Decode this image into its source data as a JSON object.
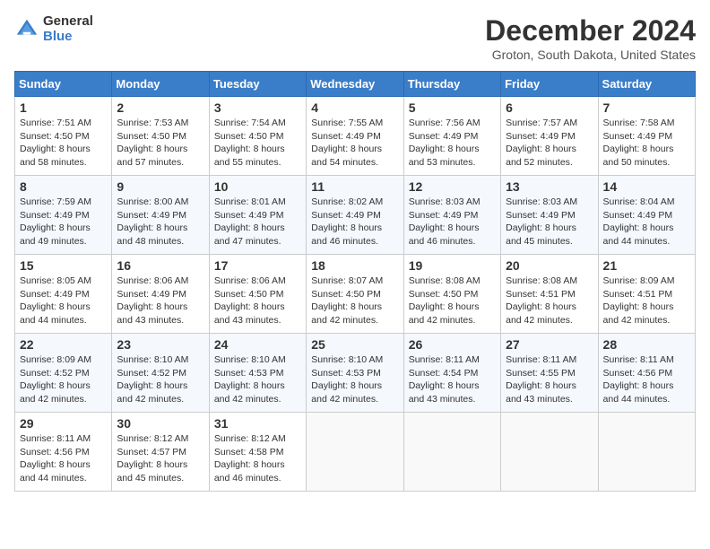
{
  "header": {
    "logo_general": "General",
    "logo_blue": "Blue",
    "month_title": "December 2024",
    "location": "Groton, South Dakota, United States"
  },
  "days_of_week": [
    "Sunday",
    "Monday",
    "Tuesday",
    "Wednesday",
    "Thursday",
    "Friday",
    "Saturday"
  ],
  "weeks": [
    [
      {
        "day": "1",
        "sunrise": "7:51 AM",
        "sunset": "4:50 PM",
        "daylight": "8 hours and 58 minutes."
      },
      {
        "day": "2",
        "sunrise": "7:53 AM",
        "sunset": "4:50 PM",
        "daylight": "8 hours and 57 minutes."
      },
      {
        "day": "3",
        "sunrise": "7:54 AM",
        "sunset": "4:50 PM",
        "daylight": "8 hours and 55 minutes."
      },
      {
        "day": "4",
        "sunrise": "7:55 AM",
        "sunset": "4:49 PM",
        "daylight": "8 hours and 54 minutes."
      },
      {
        "day": "5",
        "sunrise": "7:56 AM",
        "sunset": "4:49 PM",
        "daylight": "8 hours and 53 minutes."
      },
      {
        "day": "6",
        "sunrise": "7:57 AM",
        "sunset": "4:49 PM",
        "daylight": "8 hours and 52 minutes."
      },
      {
        "day": "7",
        "sunrise": "7:58 AM",
        "sunset": "4:49 PM",
        "daylight": "8 hours and 50 minutes."
      }
    ],
    [
      {
        "day": "8",
        "sunrise": "7:59 AM",
        "sunset": "4:49 PM",
        "daylight": "8 hours and 49 minutes."
      },
      {
        "day": "9",
        "sunrise": "8:00 AM",
        "sunset": "4:49 PM",
        "daylight": "8 hours and 48 minutes."
      },
      {
        "day": "10",
        "sunrise": "8:01 AM",
        "sunset": "4:49 PM",
        "daylight": "8 hours and 47 minutes."
      },
      {
        "day": "11",
        "sunrise": "8:02 AM",
        "sunset": "4:49 PM",
        "daylight": "8 hours and 46 minutes."
      },
      {
        "day": "12",
        "sunrise": "8:03 AM",
        "sunset": "4:49 PM",
        "daylight": "8 hours and 46 minutes."
      },
      {
        "day": "13",
        "sunrise": "8:03 AM",
        "sunset": "4:49 PM",
        "daylight": "8 hours and 45 minutes."
      },
      {
        "day": "14",
        "sunrise": "8:04 AM",
        "sunset": "4:49 PM",
        "daylight": "8 hours and 44 minutes."
      }
    ],
    [
      {
        "day": "15",
        "sunrise": "8:05 AM",
        "sunset": "4:49 PM",
        "daylight": "8 hours and 44 minutes."
      },
      {
        "day": "16",
        "sunrise": "8:06 AM",
        "sunset": "4:49 PM",
        "daylight": "8 hours and 43 minutes."
      },
      {
        "day": "17",
        "sunrise": "8:06 AM",
        "sunset": "4:50 PM",
        "daylight": "8 hours and 43 minutes."
      },
      {
        "day": "18",
        "sunrise": "8:07 AM",
        "sunset": "4:50 PM",
        "daylight": "8 hours and 42 minutes."
      },
      {
        "day": "19",
        "sunrise": "8:08 AM",
        "sunset": "4:50 PM",
        "daylight": "8 hours and 42 minutes."
      },
      {
        "day": "20",
        "sunrise": "8:08 AM",
        "sunset": "4:51 PM",
        "daylight": "8 hours and 42 minutes."
      },
      {
        "day": "21",
        "sunrise": "8:09 AM",
        "sunset": "4:51 PM",
        "daylight": "8 hours and 42 minutes."
      }
    ],
    [
      {
        "day": "22",
        "sunrise": "8:09 AM",
        "sunset": "4:52 PM",
        "daylight": "8 hours and 42 minutes."
      },
      {
        "day": "23",
        "sunrise": "8:10 AM",
        "sunset": "4:52 PM",
        "daylight": "8 hours and 42 minutes."
      },
      {
        "day": "24",
        "sunrise": "8:10 AM",
        "sunset": "4:53 PM",
        "daylight": "8 hours and 42 minutes."
      },
      {
        "day": "25",
        "sunrise": "8:10 AM",
        "sunset": "4:53 PM",
        "daylight": "8 hours and 42 minutes."
      },
      {
        "day": "26",
        "sunrise": "8:11 AM",
        "sunset": "4:54 PM",
        "daylight": "8 hours and 43 minutes."
      },
      {
        "day": "27",
        "sunrise": "8:11 AM",
        "sunset": "4:55 PM",
        "daylight": "8 hours and 43 minutes."
      },
      {
        "day": "28",
        "sunrise": "8:11 AM",
        "sunset": "4:56 PM",
        "daylight": "8 hours and 44 minutes."
      }
    ],
    [
      {
        "day": "29",
        "sunrise": "8:11 AM",
        "sunset": "4:56 PM",
        "daylight": "8 hours and 44 minutes."
      },
      {
        "day": "30",
        "sunrise": "8:12 AM",
        "sunset": "4:57 PM",
        "daylight": "8 hours and 45 minutes."
      },
      {
        "day": "31",
        "sunrise": "8:12 AM",
        "sunset": "4:58 PM",
        "daylight": "8 hours and 46 minutes."
      },
      null,
      null,
      null,
      null
    ]
  ],
  "labels": {
    "sunrise": "Sunrise:",
    "sunset": "Sunset:",
    "daylight": "Daylight:"
  }
}
